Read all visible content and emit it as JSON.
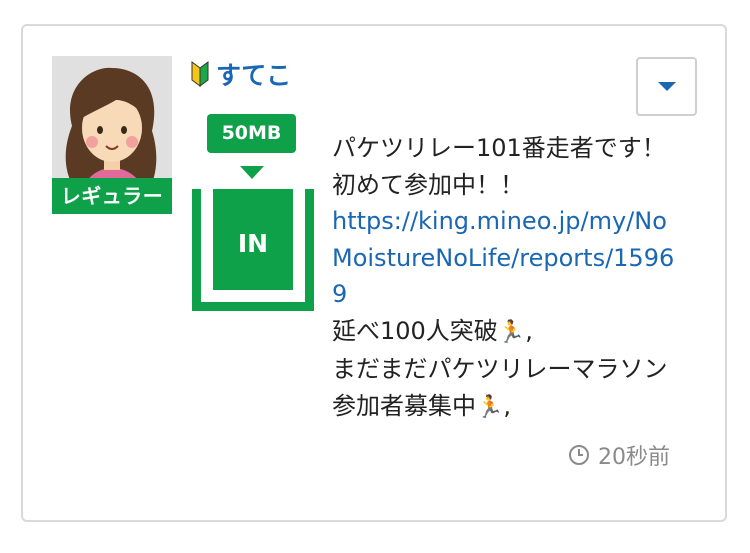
{
  "user": {
    "name": "すてこ",
    "rank": "レギュラー"
  },
  "relay": {
    "amount": "50MB",
    "direction": "IN"
  },
  "message": {
    "line1": "パケツリレー101番走者です！初めて参加中！！",
    "link": "https://king.mineo.jp/my/NoMoistureNoLife/reports/15969",
    "line3": "延べ100人突破",
    "line3_suffix": ",",
    "line4": "まだまだパケツリレーマラソン参加者募集中",
    "line4_suffix": ",",
    "runner_emoji": "🏃"
  },
  "timestamp": "20秒前",
  "icons": {
    "beginner": "beginner-mark-icon",
    "clock": "clock-icon",
    "dropdown": "caret-down-icon"
  },
  "colors": {
    "accent_green": "#0fa14a",
    "link_blue": "#1a67b3",
    "muted_text": "#8a8a8a"
  }
}
